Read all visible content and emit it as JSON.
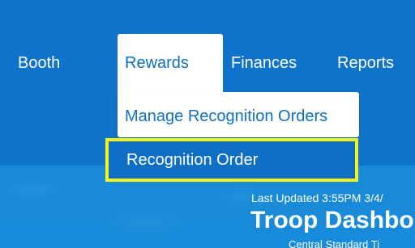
{
  "nav": {
    "booth": "Booth",
    "rewards": "Rewards",
    "finances": "Finances",
    "reports": "Reports"
  },
  "rewards_menu": {
    "manage_recognition_orders": "Manage Recognition Orders",
    "recognition_order": "Recognition Order"
  },
  "dashboard": {
    "last_updated": "Last Updated 3:55PM 3/4/",
    "title": "Troop Dashbo",
    "timezone": "Central Standard Ti"
  },
  "colors": {
    "nav_background": "#0f73cc",
    "active_tab": "#ffffff",
    "link_blue": "#1170bf",
    "highlight_border": "#f6f416"
  }
}
